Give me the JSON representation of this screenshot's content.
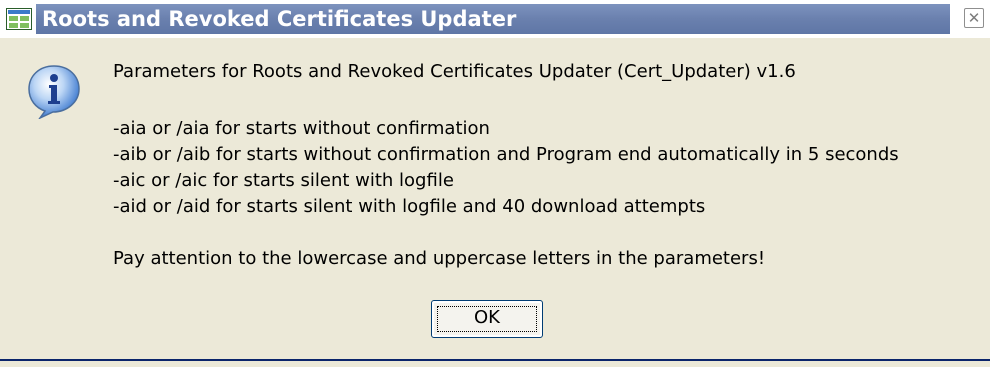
{
  "window": {
    "title": "Roots and Revoked Certificates Updater",
    "close_glyph": "✕"
  },
  "message": {
    "line1": "Parameters for Roots and Revoked Certificates Updater (Cert_Updater) v1.6",
    "line2": "-aia or /aia for starts without confirmation",
    "line3": "-aib or /aib for starts without confirmation and Program end automatically in 5 seconds",
    "line4": "-aic or /aic for starts silent with logfile",
    "line5": "-aid or /aid for starts silent with logfile and 40 download attempts",
    "line6": "Pay attention to the lowercase and uppercase letters in the parameters!"
  },
  "buttons": {
    "ok_label": "OK"
  },
  "icons": {
    "app": "app-window-icon",
    "info": "information-icon",
    "close": "close-icon"
  },
  "colors": {
    "dialog_bg": "#ece9d8",
    "title_text": "#ffffff",
    "info_blue": "#2f6fd0"
  }
}
